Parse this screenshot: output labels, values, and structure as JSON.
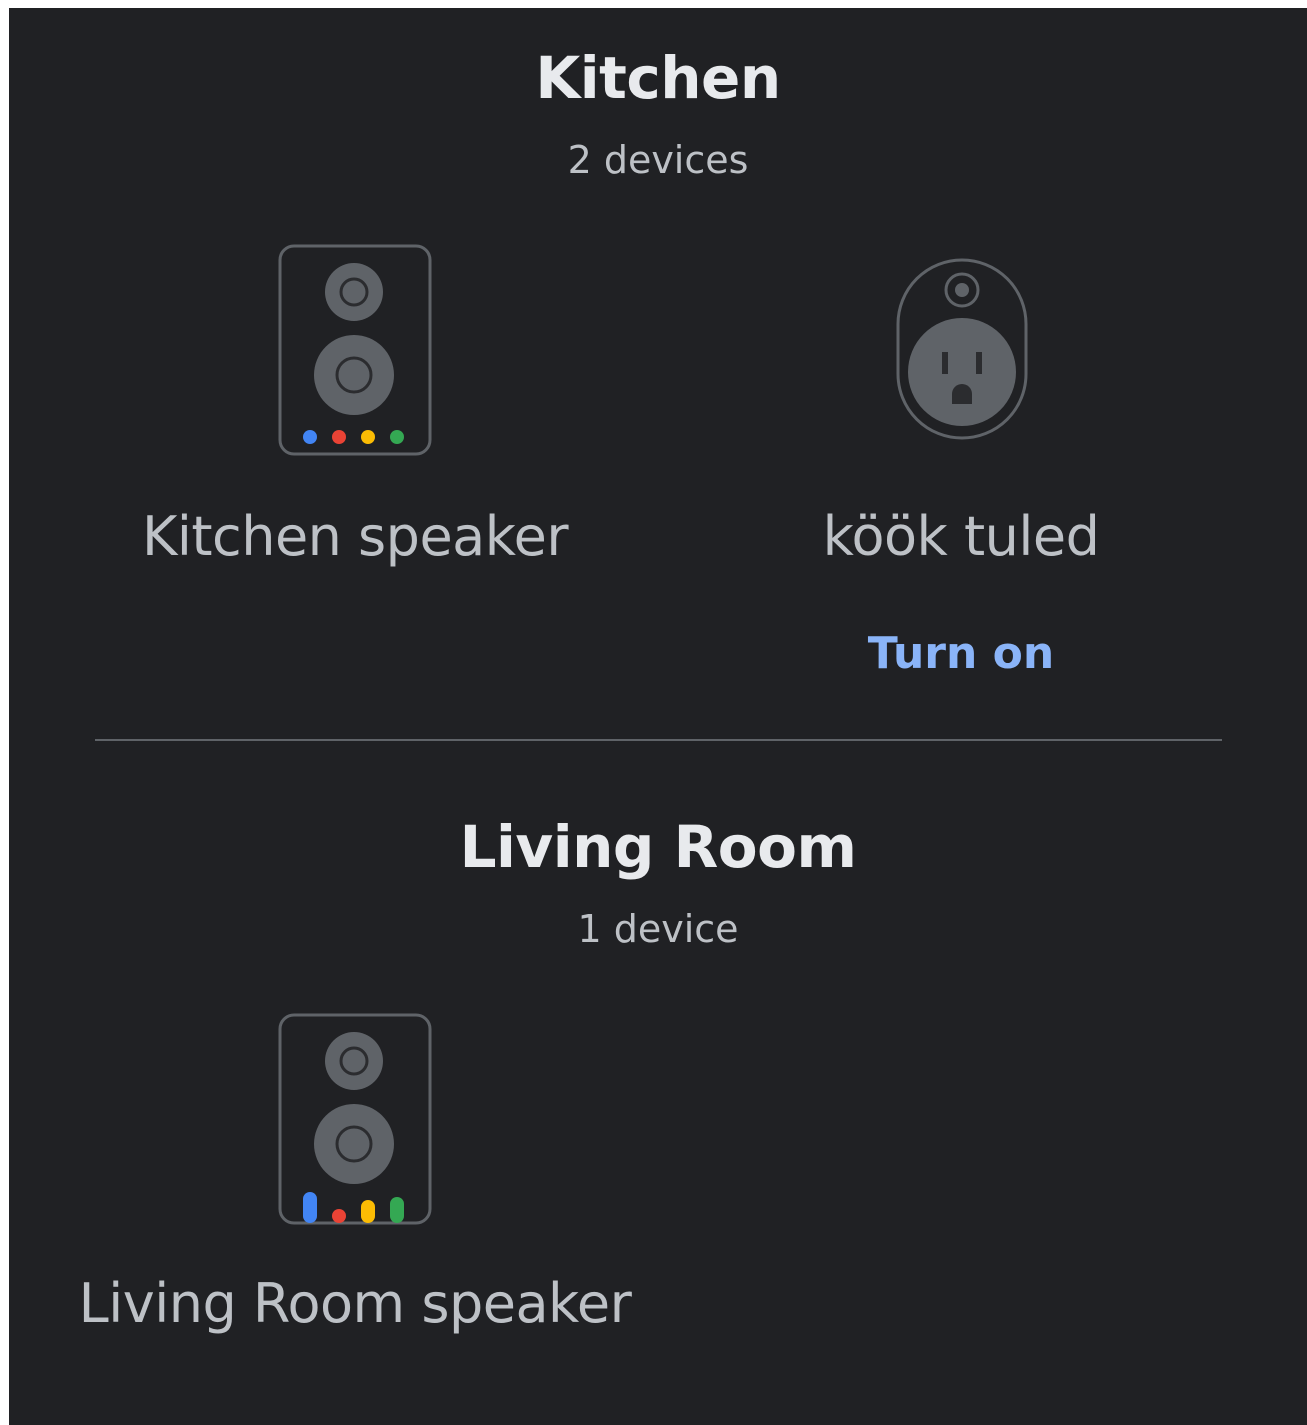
{
  "colors": {
    "background": "#202124",
    "title": "#e8eaed",
    "secondary_text": "#bdc1c6",
    "icon_outline": "#5f6368",
    "icon_fill": "#5f6368",
    "action": "#8ab4f8",
    "google_blue": "#4285f4",
    "google_red": "#ea4335",
    "google_yellow": "#fbbc04",
    "google_green": "#34a853"
  },
  "rooms": [
    {
      "title": "Kitchen",
      "count": "2 devices",
      "devices": [
        {
          "name": "Kitchen speaker",
          "icon": "smart-speaker-icon"
        },
        {
          "name": "köök tuled",
          "icon": "smart-plug-icon",
          "action": "Turn on"
        }
      ]
    },
    {
      "title": "Living Room",
      "count": "1 device",
      "devices": [
        {
          "name": "Living Room speaker",
          "icon": "smart-speaker-active-icon"
        }
      ]
    }
  ]
}
